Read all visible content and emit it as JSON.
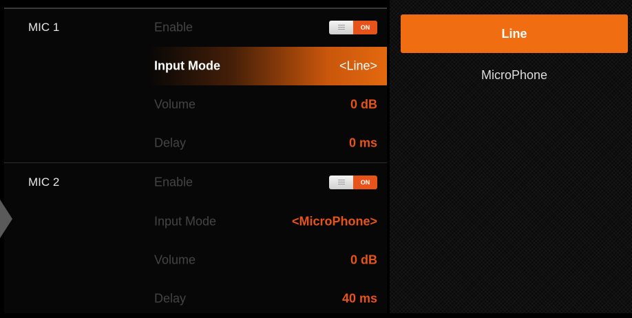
{
  "mic1": {
    "label": "MIC 1",
    "enable_label": "Enable",
    "enable_state": "ON",
    "input_mode_label": "Input Mode",
    "input_mode_value": "<Line>",
    "volume_label": "Volume",
    "volume_value": "0 dB",
    "delay_label": "Delay",
    "delay_value": "0 ms"
  },
  "mic2": {
    "label": "MIC 2",
    "enable_label": "Enable",
    "enable_state": "ON",
    "input_mode_label": "Input Mode",
    "input_mode_value": "<MicroPhone>",
    "volume_label": "Volume",
    "volume_value": "0 dB",
    "delay_label": "Delay",
    "delay_value": "40 ms"
  },
  "options": {
    "items": [
      {
        "label": "Line",
        "selected": true
      },
      {
        "label": "MicroPhone",
        "selected": false
      }
    ]
  },
  "colors": {
    "accent": "#e8531a",
    "selected_option": "#f06d12",
    "background": "#000000"
  },
  "icons": {
    "left_nav": "left-arrow-icon",
    "toggle_grip": "grip-icon"
  }
}
